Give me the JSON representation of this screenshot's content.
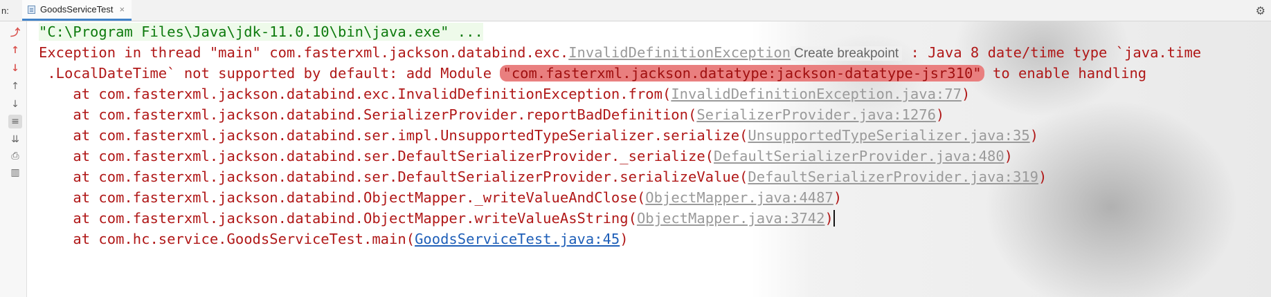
{
  "tabbar": {
    "run_label": "n:",
    "tab_label": "GoodsServiceTest",
    "close_label": "×"
  },
  "toolbar": {
    "items": [
      {
        "name": "rerun-icon",
        "glyph": "⤴"
      },
      {
        "name": "up-arrow-red-icon",
        "glyph": "↑"
      },
      {
        "name": "down-arrow-red-icon",
        "glyph": "↓"
      },
      {
        "name": "up-arrow-icon",
        "glyph": "↑"
      },
      {
        "name": "down-arrow-icon",
        "glyph": "↓"
      },
      {
        "name": "soft-wrap-icon",
        "glyph": "⇆"
      },
      {
        "name": "scroll-to-end-icon",
        "glyph": "⇊"
      },
      {
        "name": "print-icon",
        "glyph": "⎙"
      },
      {
        "name": "trash-icon",
        "glyph": "🗑"
      }
    ]
  },
  "console": {
    "command": "\"C:\\Program Files\\Java\\jdk-11.0.10\\bin\\java.exe\" ...",
    "exception_prefix": "Exception in thread \"main\" com.fasterxml.jackson.databind.exc.",
    "exception_class_link": "InvalidDefinitionException",
    "tooltip": "Create breakpoint",
    "exception_suffix": " : Java 8 date/time type `java.time",
    "line2_prefix": " .LocalDateTime` not supported by default: add Module ",
    "line2_highlight": "\"com.fasterxml.jackson.datatype:jackson-datatype-jsr310\"",
    "line2_suffix": " to enable handling",
    "stack": [
      {
        "text": "    at com.fasterxml.jackson.databind.exc.InvalidDefinitionException.from(",
        "link": "InvalidDefinitionException.java:77",
        "end": ")"
      },
      {
        "text": "    at com.fasterxml.jackson.databind.SerializerProvider.reportBadDefinition(",
        "link": "SerializerProvider.java:1276",
        "end": ")"
      },
      {
        "text": "    at com.fasterxml.jackson.databind.ser.impl.UnsupportedTypeSerializer.serialize(",
        "link": "UnsupportedTypeSerializer.java:35",
        "end": ")"
      },
      {
        "text": "    at com.fasterxml.jackson.databind.ser.DefaultSerializerProvider._serialize(",
        "link": "DefaultSerializerProvider.java:480",
        "end": ")"
      },
      {
        "text": "    at com.fasterxml.jackson.databind.ser.DefaultSerializerProvider.serializeValue(",
        "link": "DefaultSerializerProvider.java:319",
        "end": ")"
      },
      {
        "text": "    at com.fasterxml.jackson.databind.ObjectMapper._writeValueAndClose(",
        "link": "ObjectMapper.java:4487",
        "end": ")"
      },
      {
        "text": "    at com.fasterxml.jackson.databind.ObjectMapper.writeValueAsString(",
        "link": "ObjectMapper.java:3742",
        "end": ")"
      },
      {
        "text": "    at com.hc.service.GoodsServiceTest.main(",
        "link": "GoodsServiceTest.java:45",
        "end": ")"
      }
    ]
  },
  "colors": {
    "error_text": "#b01818",
    "command_text": "#0d7a0d",
    "link_gray": "#9a9a9a",
    "link_blue": "#1f5fb8",
    "highlight": "#e97f7f"
  }
}
